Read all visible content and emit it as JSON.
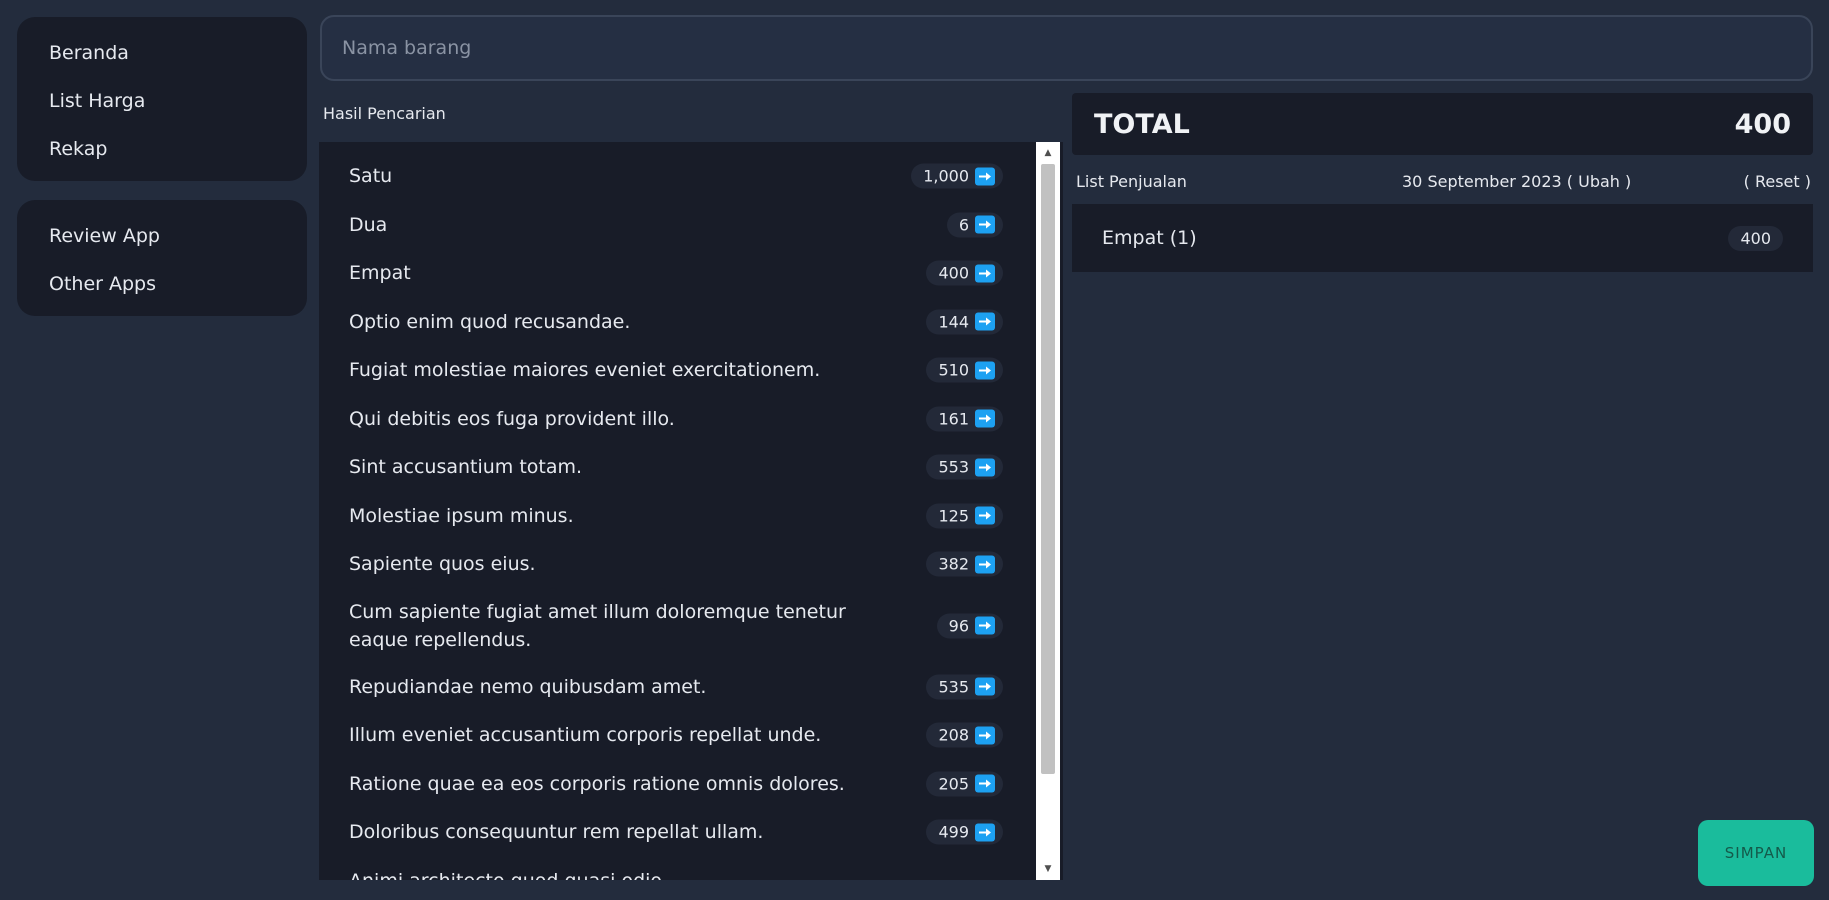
{
  "sidebar": {
    "main": [
      "Beranda",
      "List Harga",
      "Rekap"
    ],
    "other": [
      "Review App",
      "Other Apps"
    ]
  },
  "search": {
    "placeholder": "Nama barang",
    "value": ""
  },
  "results": {
    "label": "Hasil Pencarian",
    "items": [
      {
        "name": "Satu",
        "price": "1,000"
      },
      {
        "name": "Dua",
        "price": "6"
      },
      {
        "name": "Empat",
        "price": "400"
      },
      {
        "name": "Optio enim quod recusandae.",
        "price": "144"
      },
      {
        "name": "Fugiat molestiae maiores eveniet exercitationem.",
        "price": "510"
      },
      {
        "name": "Qui debitis eos fuga provident illo.",
        "price": "161"
      },
      {
        "name": "Sint accusantium totam.",
        "price": "553"
      },
      {
        "name": "Molestiae ipsum minus.",
        "price": "125"
      },
      {
        "name": "Sapiente quos eius.",
        "price": "382"
      },
      {
        "name": "Cum sapiente fugiat amet illum doloremque tenetur eaque repellendus.",
        "price": "96"
      },
      {
        "name": "Repudiandae nemo quibusdam amet.",
        "price": "535"
      },
      {
        "name": "Illum eveniet accusantium corporis repellat unde.",
        "price": "208"
      },
      {
        "name": "Ratione quae ea eos corporis ratione omnis dolores.",
        "price": "205"
      },
      {
        "name": "Doloribus consequuntur rem repellat ullam.",
        "price": "499"
      },
      {
        "name": "Animi architecto quod quasi odio.",
        "price": ""
      }
    ]
  },
  "total": {
    "label": "TOTAL",
    "value": "400"
  },
  "sales": {
    "title": "List Penjualan",
    "date": "30 September 2023 ( Ubah )",
    "reset": "( Reset )",
    "items": [
      {
        "name": "Empat (1)",
        "price": "400"
      }
    ]
  },
  "save_label": "SIMPAN",
  "colors": {
    "background": "#232c3d",
    "panel": "#181c28",
    "accent": "#1da1f2",
    "save": "#1abc9c"
  }
}
